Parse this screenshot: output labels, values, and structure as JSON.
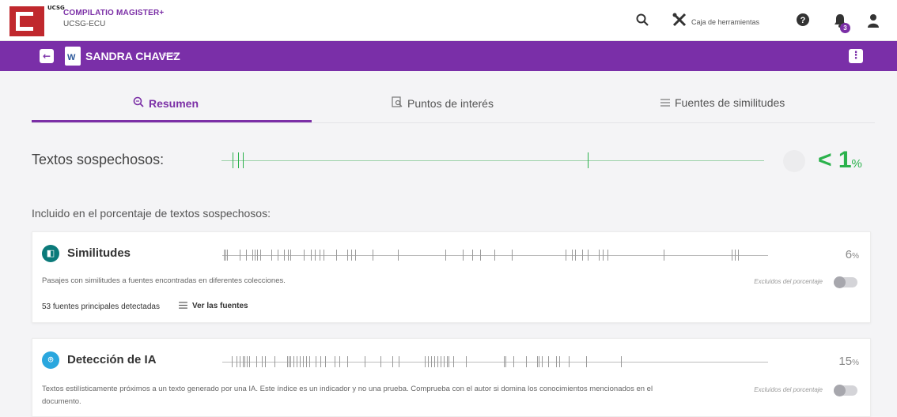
{
  "app": {
    "brand": "COMPILATIO MAGISTER+",
    "org": "UCSG-ECU",
    "logo_letters": "UCSG",
    "toolbox_label": "Caja de herramientas",
    "notification_count": "3"
  },
  "document": {
    "name": "SANDRA CHAVEZ",
    "id": "#bf63fd",
    "file_icon_letter": "W"
  },
  "tabs": [
    {
      "label": "Resumen",
      "icon": "magnify-icon",
      "active": true
    },
    {
      "label": "Puntos de interés",
      "icon": "document-search-icon",
      "active": false
    },
    {
      "label": "Fuentes de similitudes",
      "icon": "list-icon",
      "active": false
    }
  ],
  "suspicious": {
    "label": "Textos sospechosos:",
    "value_text": "< 1",
    "unit": "%",
    "color": "#2bb24c"
  },
  "included_label": "Incluido en el porcentaje de textos sospechosos:",
  "similarities": {
    "title": "Similitudes",
    "percent": "6",
    "unit": "%",
    "description": "Pasajes con similitudes a fuentes encontradas en diferentes colecciones.",
    "excluded_label": "Excluidos del porcentaje",
    "sources_count_text": "53 fuentes principales detectadas",
    "view_sources_label": "Ver las fuentes",
    "icon_color": "#0b7a7a"
  },
  "ai_detection": {
    "title": "Detección de IA",
    "percent": "15",
    "unit": "%",
    "description": "Textos estilísticamente próximos a un texto generado por una IA. Este índice es un indicador y no una prueba. Comprueba con el autor si domina los conocimientos mencionados en el documento.",
    "excluded_label": "Excluidos del porcentaje",
    "icon_color": "#2aa7de"
  },
  "colors": {
    "primary": "#7b2fa6",
    "brand_red": "#c0282d"
  }
}
